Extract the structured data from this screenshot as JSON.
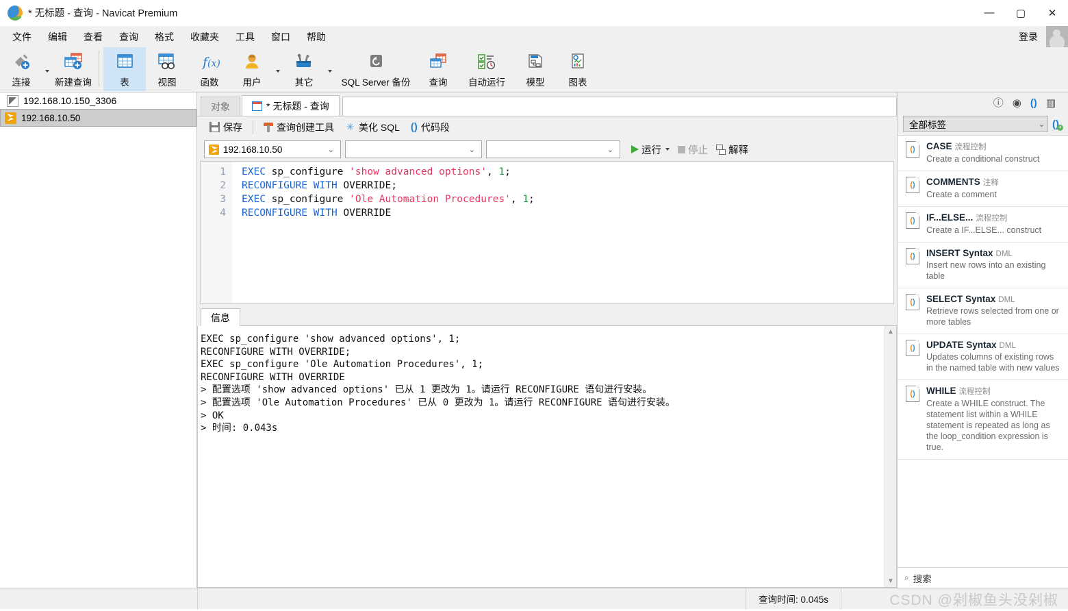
{
  "window": {
    "title": "* 无标题 - 查询 - Navicat Premium",
    "minimize": "—",
    "maximize": "▢",
    "close": "✕"
  },
  "menubar": {
    "items": [
      "文件",
      "编辑",
      "查看",
      "查询",
      "格式",
      "收藏夹",
      "工具",
      "窗口",
      "帮助"
    ],
    "login_label": "登录"
  },
  "ribbon": {
    "items": [
      {
        "label": "连接",
        "icon": "plug-add-icon",
        "caret": true
      },
      {
        "label": "新建查询",
        "icon": "new-query-icon",
        "caret": false
      },
      {
        "label": "表",
        "icon": "table-icon",
        "caret": false,
        "active": true
      },
      {
        "label": "视图",
        "icon": "view-icon",
        "caret": false
      },
      {
        "label": "函数",
        "icon": "function-icon",
        "caret": false
      },
      {
        "label": "用户",
        "icon": "user-icon",
        "caret": true
      },
      {
        "label": "其它",
        "icon": "others-icon",
        "caret": true
      },
      {
        "label": "SQL Server 备份",
        "icon": "backup-icon",
        "caret": false
      },
      {
        "label": "查询",
        "icon": "query-icon",
        "caret": false
      },
      {
        "label": "自动运行",
        "icon": "automation-icon",
        "caret": false
      },
      {
        "label": "模型",
        "icon": "model-icon",
        "caret": false
      },
      {
        "label": "图表",
        "icon": "chart-icon",
        "caret": false
      }
    ]
  },
  "sidebar": {
    "connections": [
      {
        "name": "192.168.10.150_3306",
        "icon": "mysql-icon",
        "selected": false
      },
      {
        "name": "192.168.10.50",
        "icon": "sqlserver-icon",
        "selected": true
      }
    ]
  },
  "tabs": {
    "object_tab": "对象",
    "query_tab": "* 无标题 - 查询"
  },
  "query_toolbar": {
    "save": "保存",
    "query_builder": "查询创建工具",
    "beautify_sql": "美化 SQL",
    "code_snippet": "代码段"
  },
  "selectors": {
    "connection": "192.168.10.50",
    "database": "",
    "schema": "",
    "run": "运行",
    "stop": "停止",
    "explain": "解释"
  },
  "editor": {
    "line_numbers": [
      "1",
      "2",
      "3",
      "4"
    ],
    "lines": [
      [
        {
          "t": "EXEC",
          "c": "k"
        },
        {
          "t": " sp_configure ",
          "c": "p"
        },
        {
          "t": "'show advanced options'",
          "c": "s"
        },
        {
          "t": ", ",
          "c": "p"
        },
        {
          "t": "1",
          "c": "n"
        },
        {
          "t": ";",
          "c": "p"
        }
      ],
      [
        {
          "t": "RECONFIGURE WITH",
          "c": "k"
        },
        {
          "t": " OVERRIDE;",
          "c": "p"
        }
      ],
      [
        {
          "t": "EXEC",
          "c": "k"
        },
        {
          "t": " sp_configure ",
          "c": "p"
        },
        {
          "t": "'Ole Automation Procedures'",
          "c": "s"
        },
        {
          "t": ", ",
          "c": "p"
        },
        {
          "t": "1",
          "c": "n"
        },
        {
          "t": ";",
          "c": "p"
        }
      ],
      [
        {
          "t": "RECONFIGURE WITH",
          "c": "k"
        },
        {
          "t": " OVERRIDE",
          "c": "p"
        }
      ]
    ]
  },
  "messages": {
    "tab_label": "信息",
    "text": "EXEC sp_configure 'show advanced options', 1;\nRECONFIGURE WITH OVERRIDE;\nEXEC sp_configure 'Ole Automation Procedures', 1;\nRECONFIGURE WITH OVERRIDE\n> 配置选项 'show advanced options' 已从 1 更改为 1。请运行 RECONFIGURE 语句进行安装。\n> 配置选项 'Ole Automation Procedures' 已从 0 更改为 1。请运行 RECONFIGURE 语句进行安装。\n> OK\n> 时间: 0.043s"
  },
  "right_panel": {
    "icons": [
      "info-icon",
      "eye-icon",
      "code-snippet-icon",
      "structure-icon"
    ],
    "filter_label": "全部标签",
    "add_snippet": "add-snippet-icon",
    "search_placeholder": "搜索",
    "snippets": [
      {
        "title": "CASE",
        "tag": "流程控制",
        "desc": "Create a conditional construct"
      },
      {
        "title": "COMMENTS",
        "tag": "注释",
        "desc": "Create a comment"
      },
      {
        "title": "IF...ELSE...",
        "tag": "流程控制",
        "desc": "Create a IF...ELSE... construct"
      },
      {
        "title": "INSERT Syntax",
        "tag": "DML",
        "desc": "Insert new rows into an existing table"
      },
      {
        "title": "SELECT Syntax",
        "tag": "DML",
        "desc": "Retrieve rows selected from one or more tables"
      },
      {
        "title": "UPDATE Syntax",
        "tag": "DML",
        "desc": "Updates columns of existing rows in the named table with new values"
      },
      {
        "title": "WHILE",
        "tag": "流程控制",
        "desc": "Create a WHILE construct. The statement list within a WHILE statement is repeated as long as the loop_condition expression is true."
      }
    ]
  },
  "statusbar": {
    "query_time": "查询时间: 0.045s"
  },
  "watermark": "CSDN @剁椒鱼头没剁椒"
}
